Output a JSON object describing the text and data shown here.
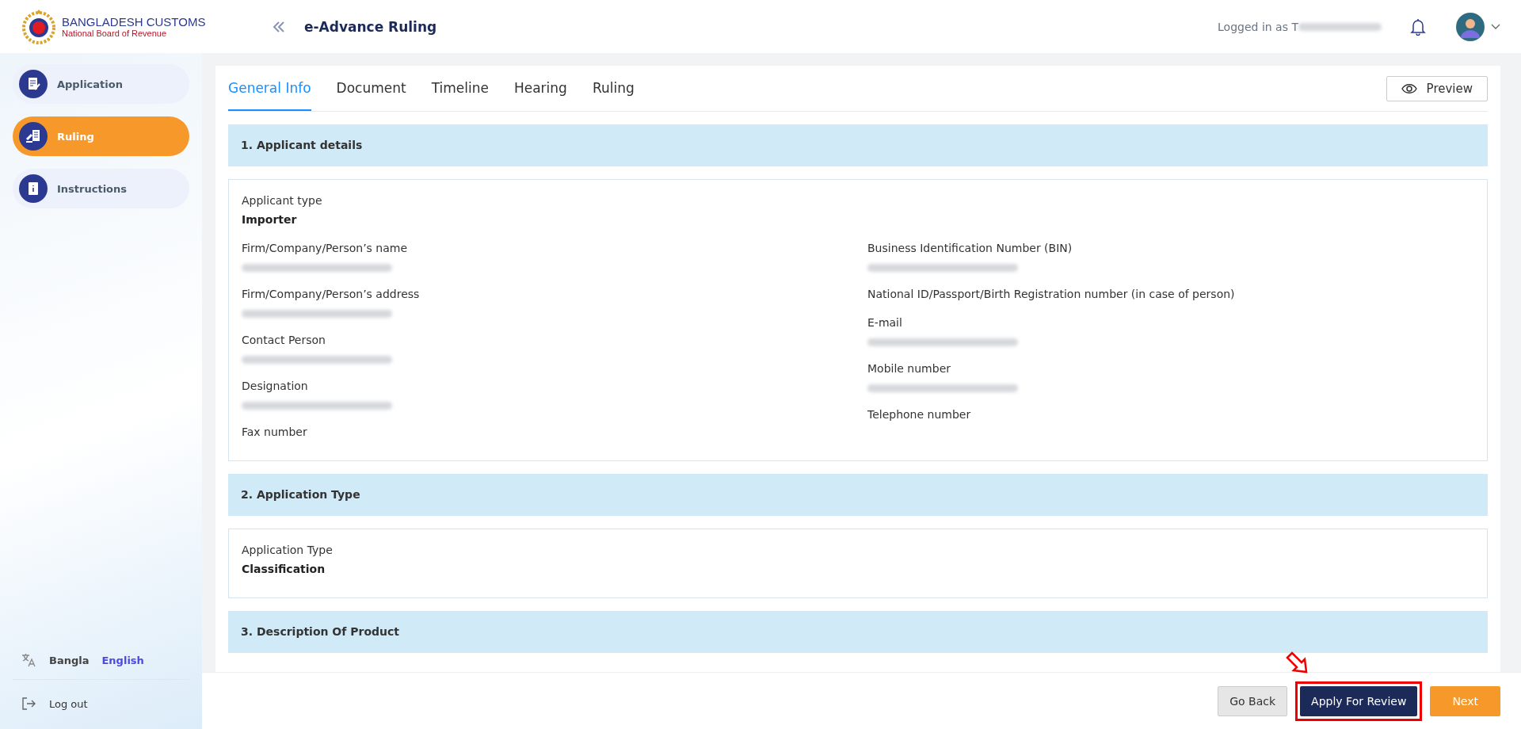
{
  "header": {
    "logo_title": "BANGLADESH CUSTOMS",
    "logo_subtitle": "National Board of Revenue",
    "page_title": "e-Advance Ruling",
    "logged_in_label": "Logged in as T"
  },
  "sidebar": {
    "items": [
      {
        "label": "Application",
        "kind": "application",
        "selected": false
      },
      {
        "label": "Ruling",
        "kind": "ruling",
        "selected": true
      },
      {
        "label": "Instructions",
        "kind": "instructions",
        "selected": false
      }
    ],
    "languages": [
      {
        "label": "Bangla",
        "selected": false
      },
      {
        "label": "English",
        "selected": true
      }
    ],
    "logout": "Log out"
  },
  "tabs": [
    {
      "label": "General Info",
      "selected": true
    },
    {
      "label": "Document",
      "selected": false
    },
    {
      "label": "Timeline",
      "selected": false
    },
    {
      "label": "Hearing",
      "selected": false
    },
    {
      "label": "Ruling",
      "selected": false
    }
  ],
  "preview_button": "Preview",
  "sections": [
    {
      "title": "1. Applicant details",
      "lead": [
        {
          "label": "Applicant type",
          "value": "Importer"
        }
      ],
      "columns": [
        [
          {
            "label": "Firm/Company/Person’s name",
            "redacted": true
          },
          {
            "label": "Firm/Company/Person’s address",
            "redacted": true
          },
          {
            "label": "Contact Person",
            "redacted": true
          },
          {
            "label": "Designation",
            "redacted": true
          },
          {
            "label": "Fax number"
          }
        ],
        [
          {
            "label": "Business Identification Number (BIN)",
            "redacted": true
          },
          {
            "label": "National ID/Passport/Birth Registration number (in case of person)"
          },
          {
            "label": "E-mail",
            "redacted": true
          },
          {
            "label": "Mobile number",
            "redacted": true
          },
          {
            "label": "Telephone number"
          }
        ]
      ]
    },
    {
      "title": "2. Application Type",
      "lead": [
        {
          "label": "Application Type",
          "value": "Classification"
        }
      ]
    },
    {
      "title": "3. Description Of Product"
    }
  ],
  "footer_buttons": [
    {
      "label": "Go Back",
      "kind": "secondary",
      "highlighted": false
    },
    {
      "label": "Apply For Review",
      "kind": "primary",
      "highlighted": true
    },
    {
      "label": "Next",
      "kind": "accent",
      "highlighted": false
    }
  ]
}
